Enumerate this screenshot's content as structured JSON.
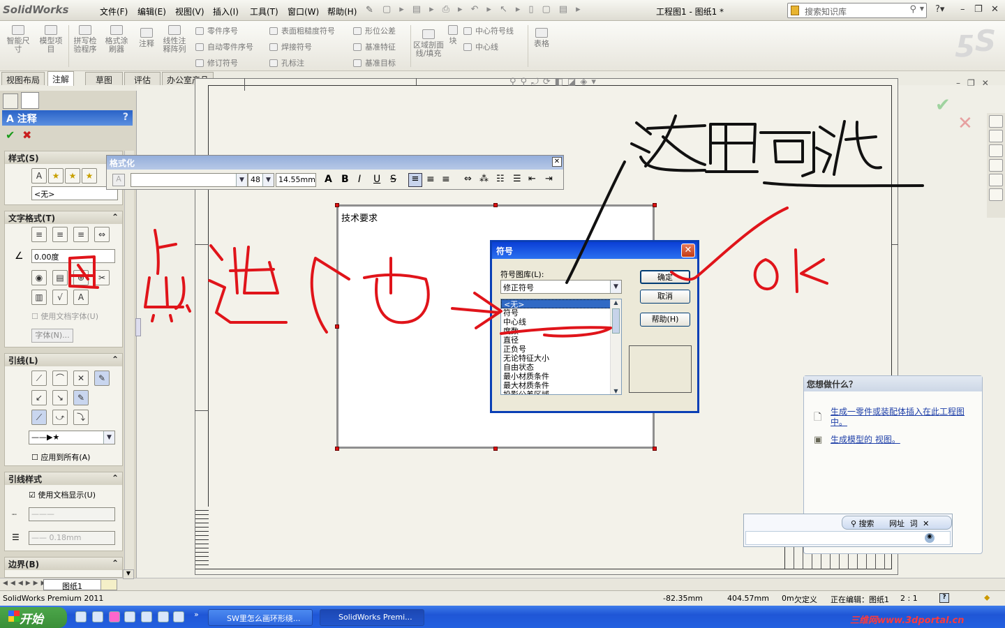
{
  "app": {
    "logo_text": "SolidWorks",
    "doc_title": "工程图1 - 图纸1 *"
  },
  "menu": [
    "文件(F)",
    "编辑(E)",
    "视图(V)",
    "插入(I)",
    "工具(T)",
    "窗口(W)",
    "帮助(H)"
  ],
  "search": {
    "placeholder": "搜索知识库"
  },
  "ribbon": {
    "big": [
      "智能尺寸",
      "模型项目",
      "拼写检验程序",
      "格式涂刷器",
      "注释",
      "线性注释阵列",
      "区域剖面线/填充",
      "块",
      "表格"
    ],
    "small": [
      "零件序号",
      "自动零件序号",
      "修订符号",
      "表面粗糙度符号",
      "焊接符号",
      "孔标注",
      "形位公差",
      "基准特征",
      "基准目标",
      "中心符号线",
      "中心线"
    ]
  },
  "tabs": [
    "视图布局",
    "注解",
    "草图",
    "评估",
    "办公室产品"
  ],
  "property_manager": {
    "title": "注释",
    "help": "?",
    "sections": {
      "style": {
        "title": "样式(S)",
        "value": "<无>"
      },
      "text_format": {
        "title": "文字格式(T)",
        "angle": "0.00度",
        "use_doc_font": "使用文档字体(U)",
        "font_button": "字体(N)..."
      },
      "leader": {
        "title": "引线(L)",
        "apply_all": "应用到所有(A)"
      },
      "leader_style": {
        "title": "引线样式",
        "use_doc_display": "使用文档显示(U)",
        "line_width": "0.18mm"
      },
      "border": {
        "title": "边界(B)"
      }
    }
  },
  "format_bar": {
    "title": "格式化",
    "font_size": "48",
    "height": "14.55mm",
    "buttons": [
      "A",
      "B",
      "I",
      "U",
      "S"
    ]
  },
  "note": {
    "text": "技术要求"
  },
  "symbol_dialog": {
    "title": "符号",
    "library_label": "符号图库(L):",
    "library_value": "修正符号",
    "items": [
      "<无>",
      "符号",
      "中心线",
      "度数",
      "直径",
      "正负号",
      "无论特征大小",
      "自由状态",
      "最小材质条件",
      "最大材质条件",
      "投影公差区域"
    ],
    "selected_index": 0,
    "ok": "确定",
    "cancel": "取消",
    "help": "帮助(H)"
  },
  "help_panel": {
    "title": "您想做什么？",
    "links": [
      "生成一零件或装配体插入在此工程图中。",
      "生成模型的 视图。"
    ]
  },
  "ime_bar": {
    "search": "搜索",
    "url": "网址",
    "word": "词"
  },
  "sheet_tab": "图纸1",
  "status_bar": {
    "app": "SolidWorks Premium 2011",
    "x": "-82.35mm",
    "y": "404.57mm",
    "z": "0m",
    "defined": "欠定义",
    "editing": "正在编辑：图纸1",
    "scale": "2 : 1"
  },
  "taskbar": {
    "start": "开始",
    "items": [
      "SW里怎么画环形绕...",
      "SolidWorks Premi..."
    ],
    "watermark": "三维网www.3dportal.cn"
  },
  "annotation": {
    "colors": {
      "red": "#e0141a",
      "black": "#111111"
    }
  }
}
